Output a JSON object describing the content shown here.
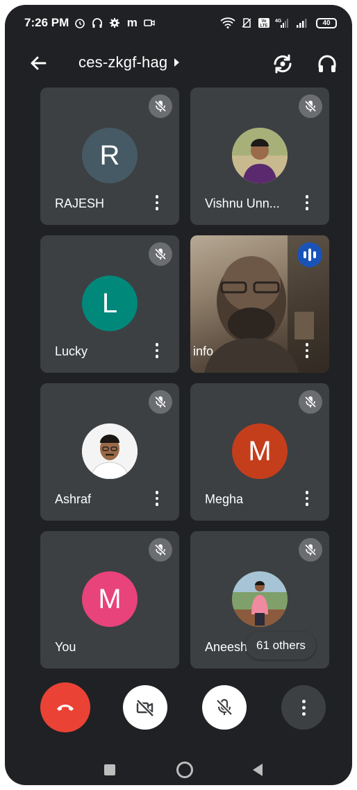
{
  "status_bar": {
    "time": "7:26 PM",
    "left_icons": [
      "alarm-icon",
      "headphones-icon",
      "settings-icon",
      "m-icon",
      "video-call-icon"
    ],
    "right_icons": [
      "wifi-icon",
      "no-sim-icon",
      "volte-icon",
      "signal-4g-icon",
      "signal-icon"
    ],
    "battery": "40"
  },
  "app_bar": {
    "meeting_code": "ces-zkgf-hag",
    "back_icon": "arrow-back-icon",
    "switch_camera_icon": "switch-camera-icon",
    "audio_icon": "headphones-icon"
  },
  "participants": [
    {
      "name": "RAJESH",
      "initial": "R",
      "avatar_color": "#455a64",
      "muted": true
    },
    {
      "name": "Vishnu Unn...",
      "initial": "",
      "avatar_color": "#7b5e57",
      "photo": true,
      "muted": true
    },
    {
      "name": "Lucky",
      "initial": "L",
      "avatar_color": "#00897b",
      "muted": true
    },
    {
      "name": "info",
      "video": true,
      "speaking": true
    },
    {
      "name": "Ashraf",
      "initial": "",
      "avatar_color": "#e0e0e0",
      "photo": true,
      "muted": true
    },
    {
      "name": "Megha",
      "initial": "M",
      "avatar_color": "#c43e1c",
      "muted": true
    },
    {
      "name": "You",
      "initial": "M",
      "avatar_color": "#e8437a",
      "muted": true
    },
    {
      "name": "Aneesh",
      "initial": "",
      "avatar_color": "#6d8f4e",
      "photo": true,
      "muted": true
    }
  ],
  "others_chip": "61 others",
  "controls": {
    "end_call_icon": "end-call-icon",
    "camera_icon": "camera-off-icon",
    "mic_icon": "mic-off-icon",
    "more_icon": "more-vert-icon"
  },
  "colors": {
    "background": "#202124",
    "tile": "#3c4043",
    "end_call": "#ea4335",
    "speaking": "#1a53b8"
  }
}
